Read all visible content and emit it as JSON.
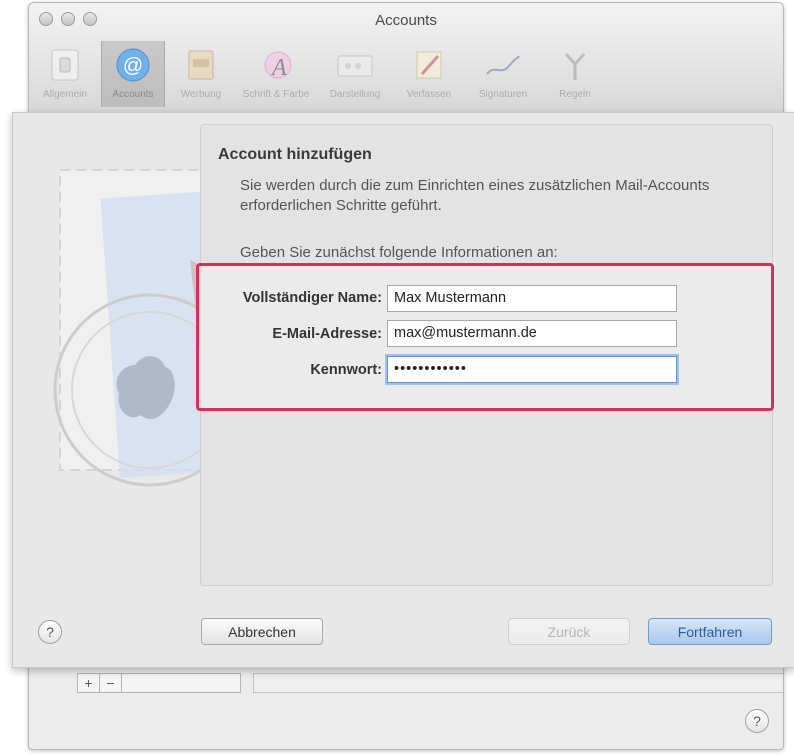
{
  "window": {
    "title": "Accounts"
  },
  "toolbar": {
    "items": [
      {
        "label": "Allgemein",
        "icon": "general-switch-icon"
      },
      {
        "label": "Accounts",
        "icon": "at-sign-icon"
      },
      {
        "label": "Werbung",
        "icon": "junk-mail-icon"
      },
      {
        "label": "Schrift & Farbe",
        "icon": "font-color-icon"
      },
      {
        "label": "Darstellung",
        "icon": "viewing-icon"
      },
      {
        "label": "Verfassen",
        "icon": "composing-pencil-icon"
      },
      {
        "label": "Signaturen",
        "icon": "signature-pen-icon"
      },
      {
        "label": "Regeln",
        "icon": "rules-icon"
      }
    ]
  },
  "sheet": {
    "heading": "Account hinzufügen",
    "description": "Sie werden durch die zum Einrichten eines zusätzlichen Mail-Accounts erforderlichen Schritte geführt.",
    "info": "Geben Sie zunächst folgende Informationen an:",
    "fields": {
      "name": {
        "label": "Vollständiger Name:",
        "value": "Max Mustermann"
      },
      "email": {
        "label": "E-Mail-Adresse:",
        "value": "max@mustermann.de"
      },
      "password": {
        "label": "Kennwort:",
        "value": "••••••••••••"
      }
    },
    "buttons": {
      "cancel": "Abbrechen",
      "back": "Zurück",
      "continue": "Fortfahren"
    },
    "help": "?"
  },
  "bottom": {
    "add": "+",
    "remove": "−",
    "help": "?"
  },
  "colors": {
    "highlight": "#d0325a",
    "accent": "#6d9bd1"
  }
}
